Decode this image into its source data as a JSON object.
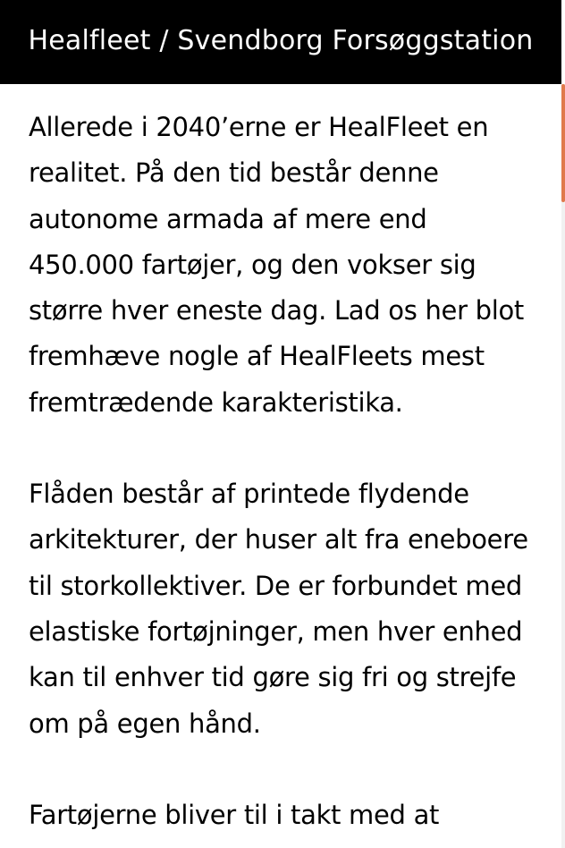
{
  "header": {
    "title": "Healfleet / Svendborg Forsøggstation"
  },
  "article": {
    "paragraphs": [
      {
        "lines": [
          "Allerede i 2040’erne er HealFleet en",
          "realitet. På den tid består denne",
          "autonome armada af mere end",
          "450.000 fartøjer, og den vokser sig",
          "større hver eneste dag. Lad os her blot",
          "fremhæve nogle af HealFleets mest",
          "fremtrædende karakteristika."
        ]
      },
      {
        "lines": [
          "Flåden består af printede flydende",
          "arkitekturer, der huser alt fra eneboere",
          "til storkollektiver. De er forbundet med",
          "elastiske fortøjninger, men hver enhed",
          "kan til enhver tid gøre sig fri og strejfe",
          "om på egen hånd."
        ]
      },
      {
        "lines": [
          "Fartøjerne bliver til i takt med at"
        ]
      }
    ]
  },
  "colors": {
    "header_background": "#000000",
    "header_text": "#ffffff",
    "scrollbar_thumb": "#e07a4c"
  }
}
